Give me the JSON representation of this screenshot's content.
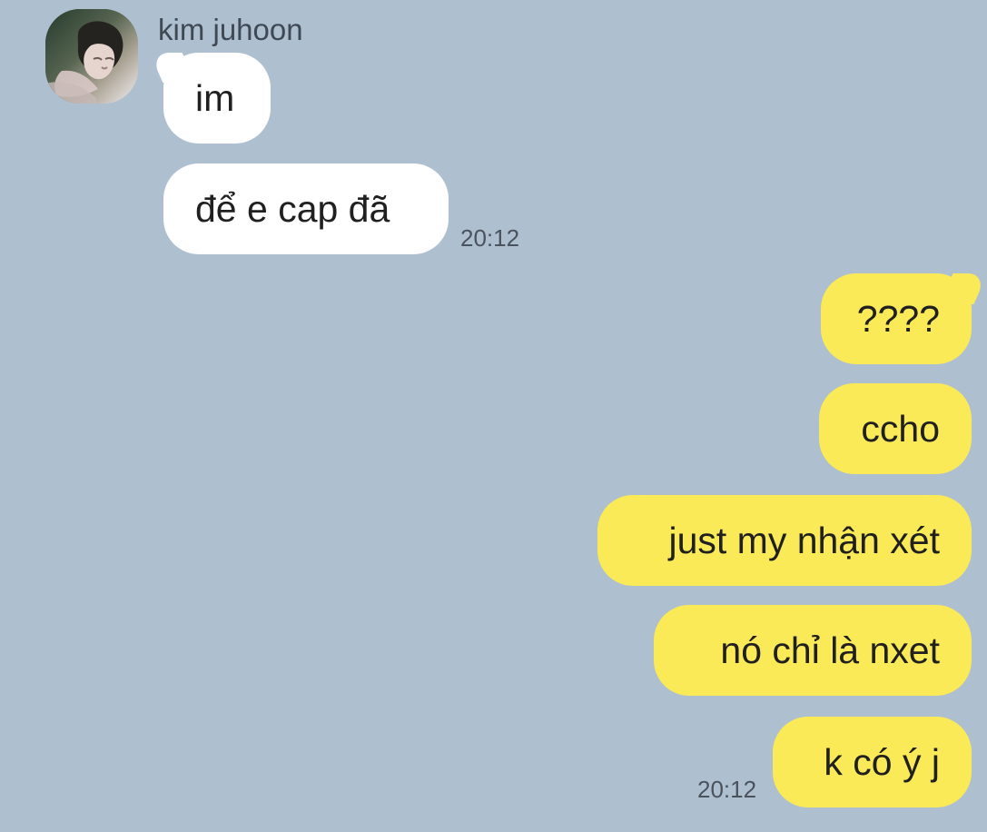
{
  "conversation": {
    "contact_name": "kim juhoon",
    "incoming": [
      {
        "text": "im"
      },
      {
        "text": "để e cap đã",
        "time": "20:12"
      }
    ],
    "outgoing": [
      {
        "text": "????"
      },
      {
        "text": "ccho"
      },
      {
        "text": "just my nhận xét"
      },
      {
        "text": "nó chỉ là nxet"
      },
      {
        "text": "k có ý j",
        "time": "20:12"
      }
    ]
  },
  "colors": {
    "background": "#aebfd0",
    "incoming_bubble": "#ffffff",
    "outgoing_bubble": "#fbea57",
    "message_text": "#202020",
    "meta_text": "#4a535d"
  },
  "icons": {
    "avatar": "profile-photo"
  }
}
